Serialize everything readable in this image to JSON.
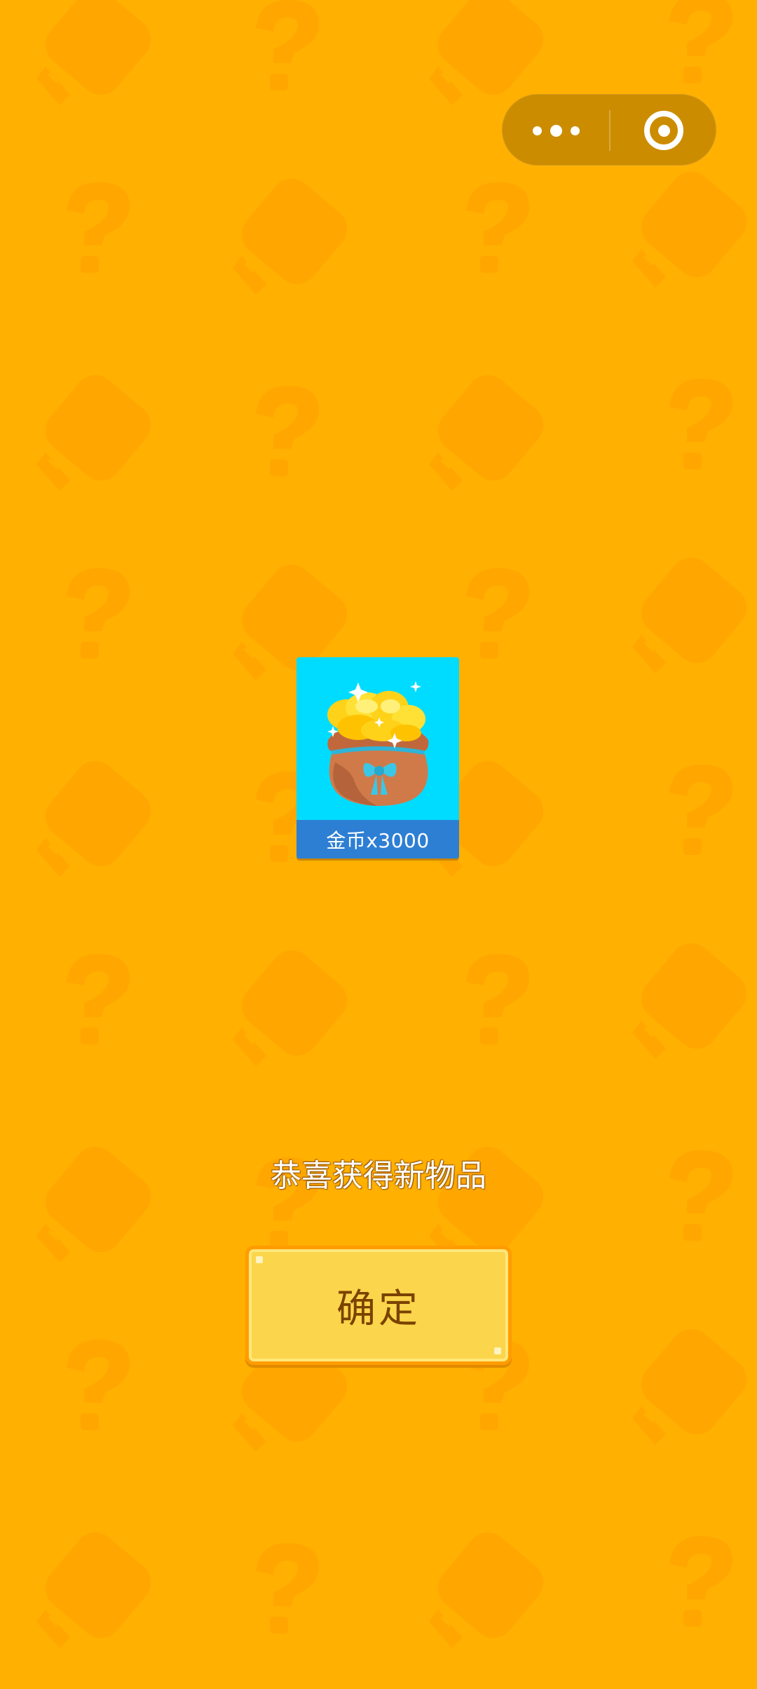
{
  "capsule": {
    "more_icon": "more-dots-icon",
    "close_icon": "target-circle-icon"
  },
  "reward": {
    "item_icon": "coin-bag-icon",
    "label": "金币x3000"
  },
  "message": "恭喜获得新物品",
  "confirm_button": {
    "label": "确定"
  },
  "colors": {
    "background": "#ffb000",
    "card": "#00dcff",
    "caption": "#2d7fd4",
    "button": "#fbd54b",
    "button_text": "#7a4200"
  }
}
